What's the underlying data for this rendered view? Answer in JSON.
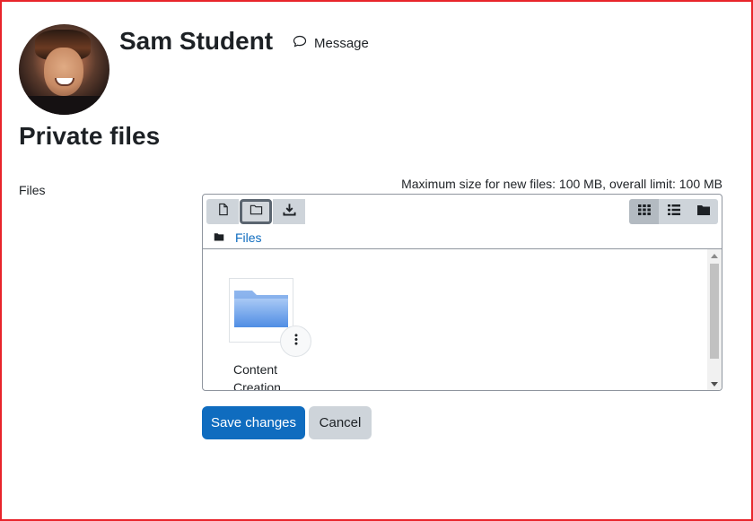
{
  "header": {
    "user_name": "Sam Student",
    "message_label": "Message"
  },
  "page": {
    "title": "Private files"
  },
  "form": {
    "field_label": "Files",
    "max_size_text": "Maximum size for new files: 100 MB, overall limit: 100 MB"
  },
  "file_manager": {
    "toolbar": [
      {
        "icon": "file-icon",
        "title": "Add..."
      },
      {
        "icon": "folder-icon",
        "title": "Create folder"
      },
      {
        "icon": "download-icon",
        "title": "Download"
      }
    ],
    "views": [
      {
        "icon": "grid-icon",
        "active": true
      },
      {
        "icon": "list-icon",
        "active": false
      },
      {
        "icon": "tree-icon",
        "active": false
      }
    ],
    "path": [
      "Files"
    ],
    "items": [
      {
        "name": "Content Creation",
        "type": "folder"
      }
    ]
  },
  "buttons": {
    "save": "Save changes",
    "cancel": "Cancel"
  },
  "colors": {
    "primary": "#0f6cbf",
    "secondary": "#ced4da",
    "frame": "#e8242b",
    "folder": "#6fa8f0"
  }
}
